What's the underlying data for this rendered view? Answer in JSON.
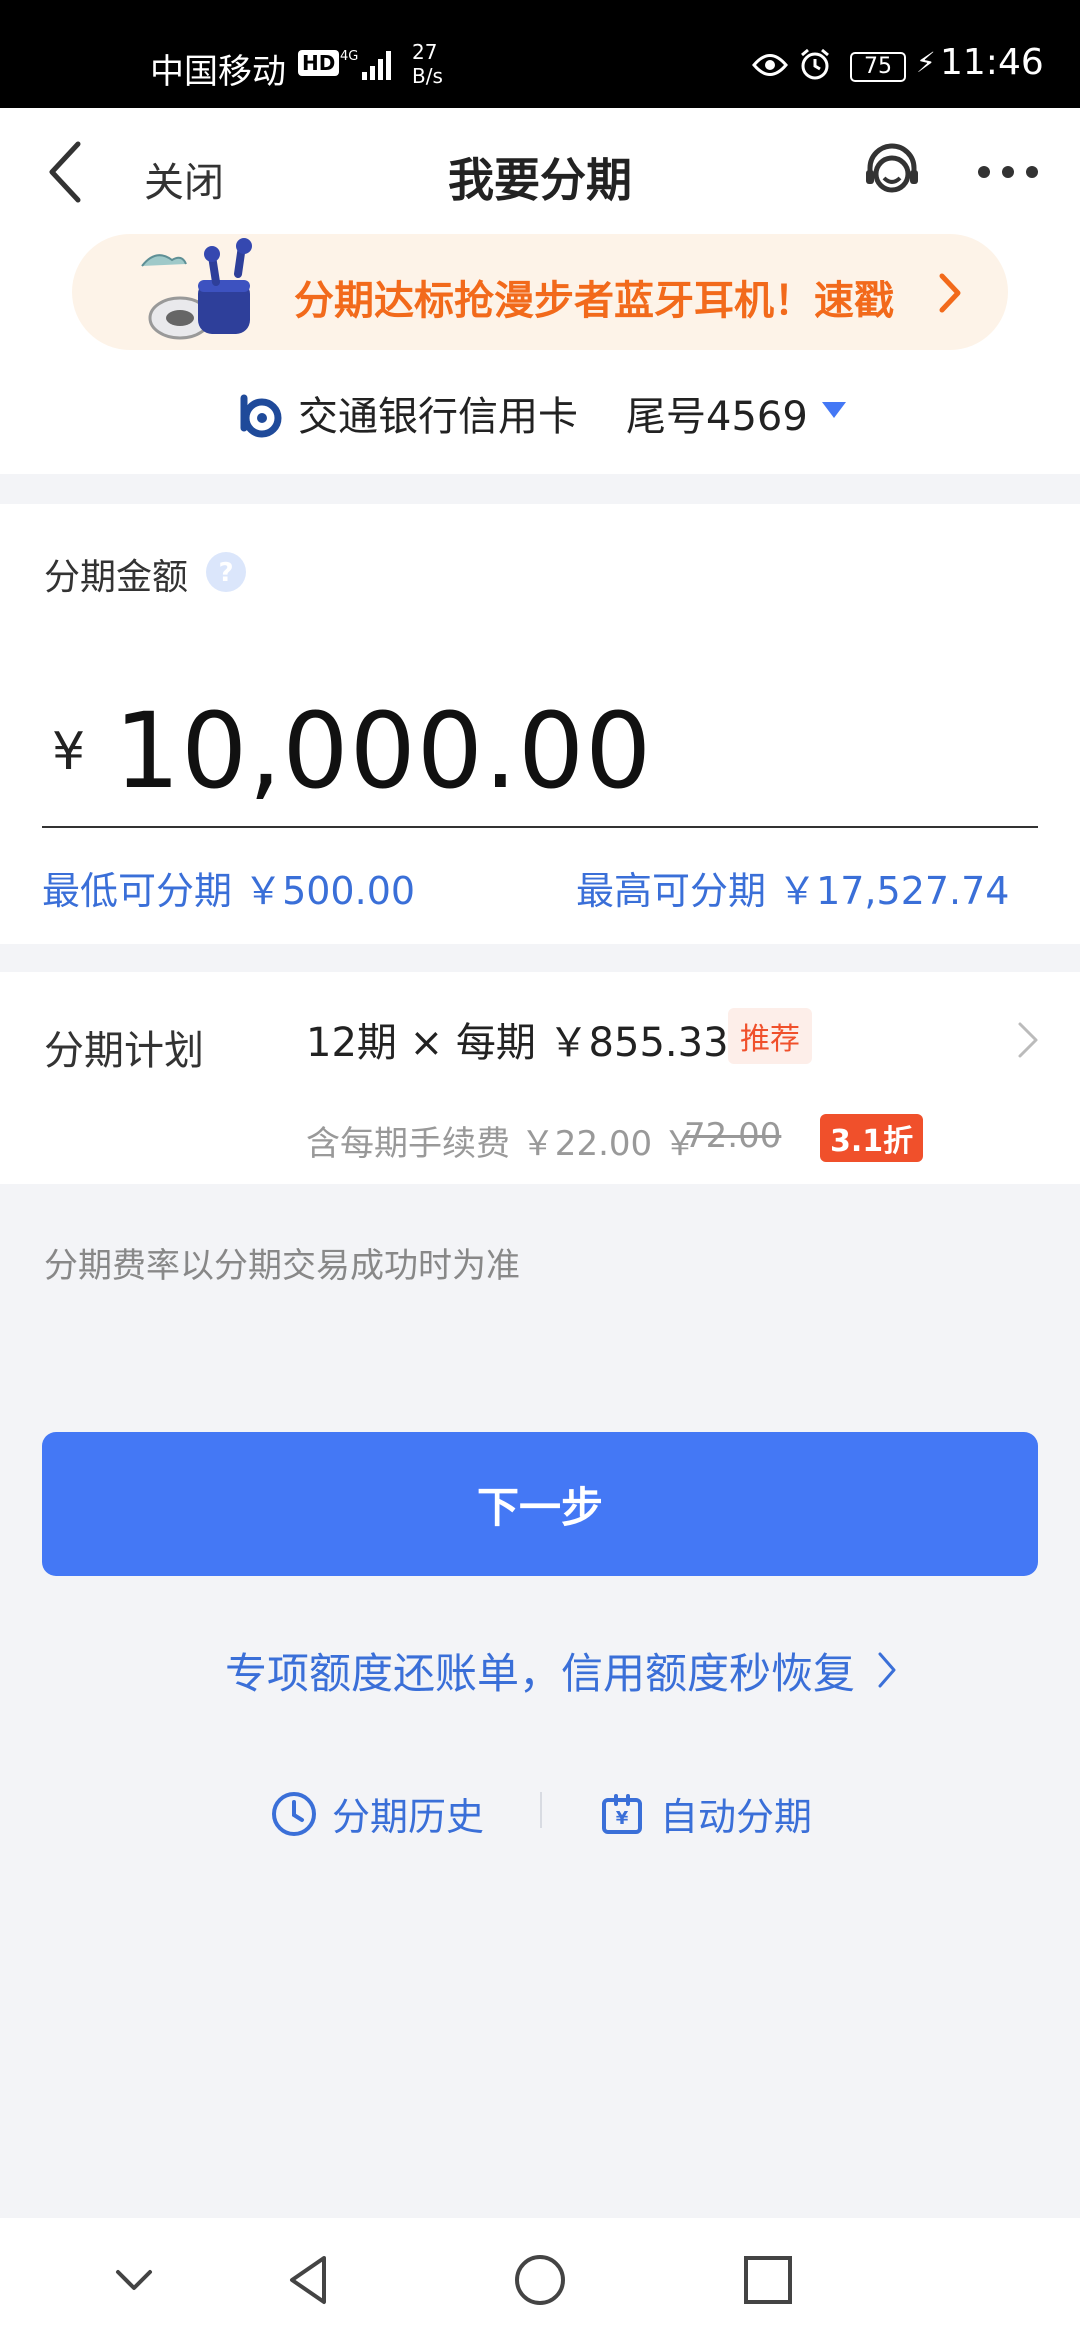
{
  "status_bar": {
    "carrier": "中国移动",
    "hd_badge": "HD",
    "network": "4G",
    "speed_value": "27",
    "speed_unit": "B/s",
    "battery": "75",
    "time": "11:46"
  },
  "header": {
    "close_label": "关闭",
    "title": "我要分期"
  },
  "banner": {
    "text": "分期达标抢漫步者蓝牙耳机！速戳"
  },
  "card": {
    "name": "交通银行信用卡",
    "tail": "尾号4569"
  },
  "amount": {
    "label": "分期金额",
    "currency": "¥",
    "value": "10,000.00",
    "min_label": "最低可分期 ￥500.00",
    "max_label": "最高可分期  ￥17,527.74"
  },
  "plan": {
    "label": "分期计划",
    "value": "12期 × 每期 ￥855.33",
    "recommend": "推荐",
    "fee_text": "含每期手续费 ￥22.00 ￥",
    "fee_original": "72.00",
    "discount": "3.1折"
  },
  "note": "分期费率以分期交易成功时为准",
  "next_button": "下一步",
  "special_link": "专项额度还账单，信用额度秒恢复",
  "bottom_links": {
    "history": "分期历史",
    "auto": "自动分期"
  },
  "colors": {
    "primary": "#4478f5",
    "link": "#3a6fd8",
    "accent_orange": "#f26a1b",
    "discount_red": "#f0502b"
  }
}
